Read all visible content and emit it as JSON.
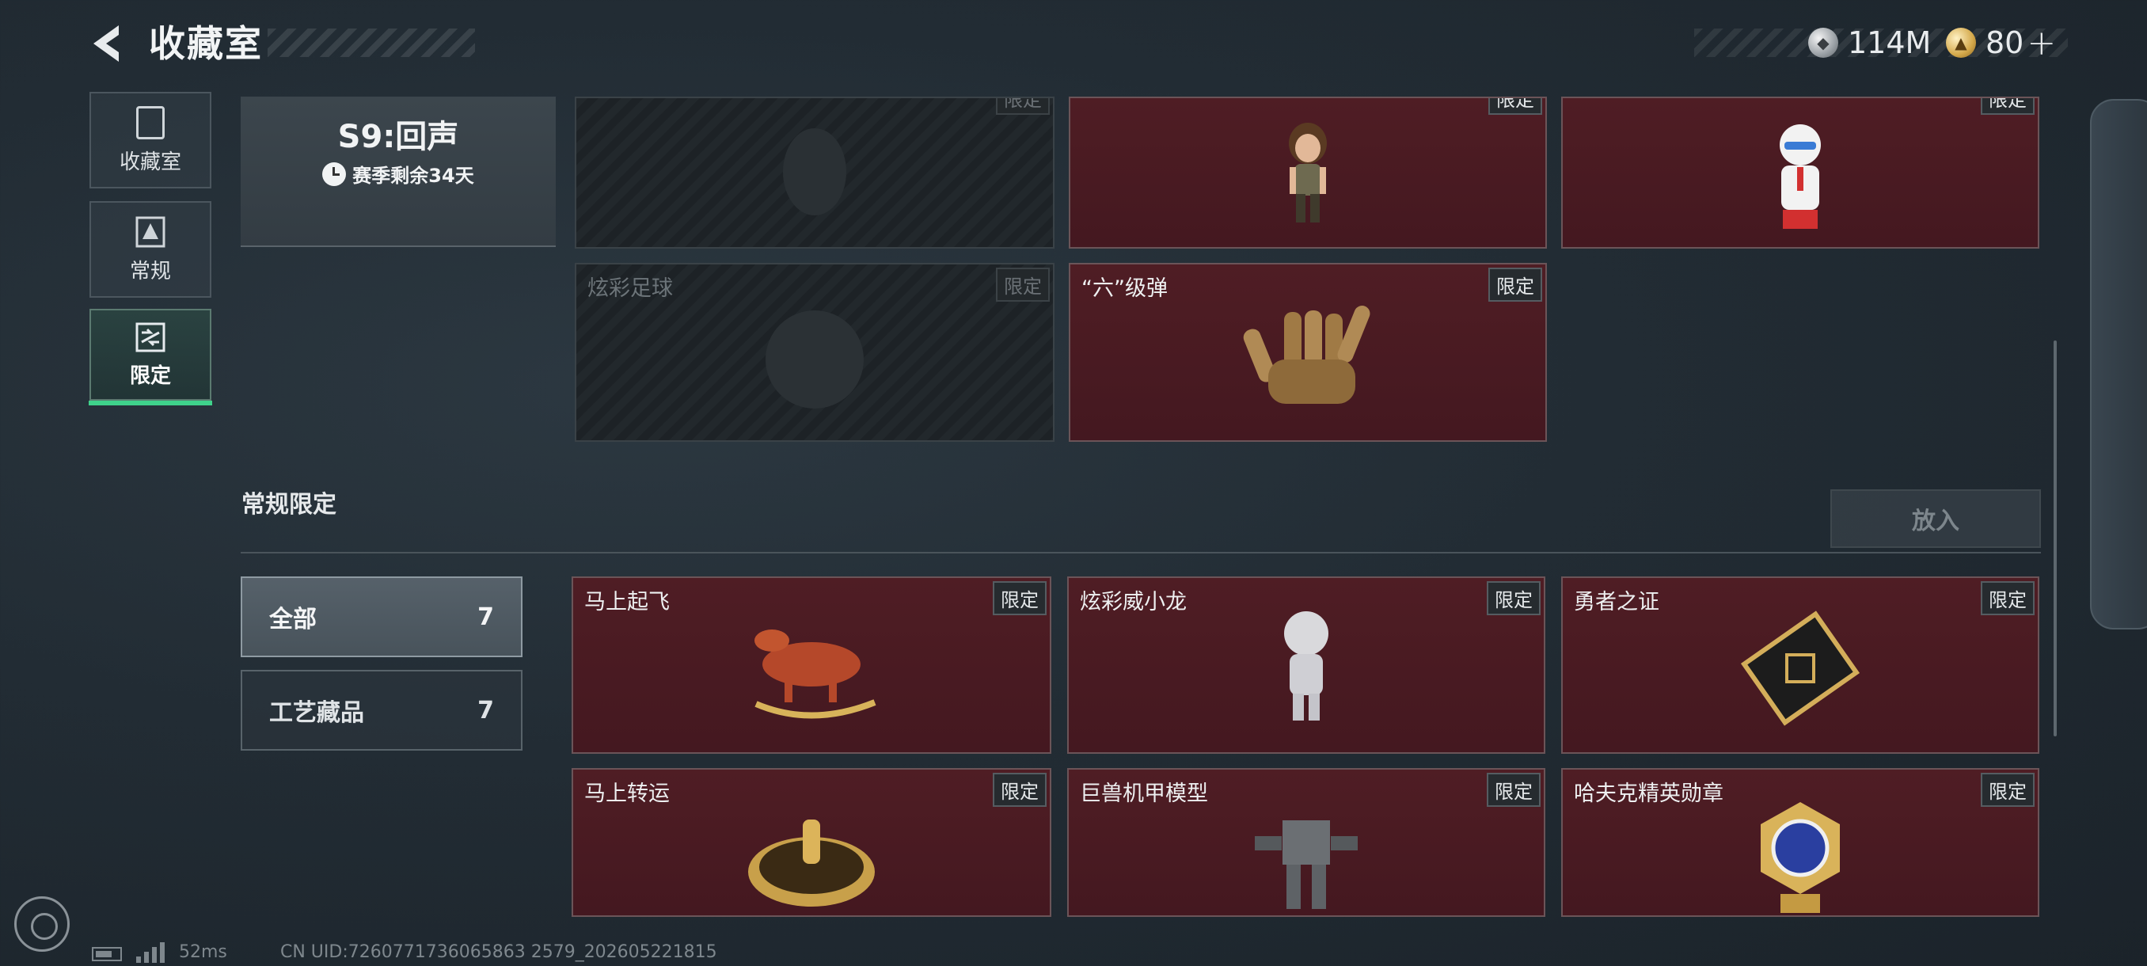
{
  "header": {
    "title": "收藏室",
    "currencies": [
      {
        "icon": "silver-coin-icon",
        "value": "114M"
      },
      {
        "icon": "gold-coin-icon",
        "value": "80"
      }
    ],
    "add_label": "+"
  },
  "nav": {
    "items": [
      {
        "label": "收藏室",
        "icon": "collection-room-icon",
        "active": false
      },
      {
        "label": "常规",
        "icon": "regular-icon",
        "active": false
      },
      {
        "label": "限定",
        "icon": "limited-icon",
        "active": true
      }
    ]
  },
  "season": {
    "title": "S9:回声",
    "remaining": "赛季剩余34天"
  },
  "limited_grid": [
    {
      "name": "",
      "tag": "限定",
      "locked": true
    },
    {
      "name": "",
      "tag": "限定",
      "locked": false
    },
    {
      "name": "",
      "tag": "限定",
      "locked": false
    },
    {
      "name": "炫彩足球",
      "tag": "限定",
      "locked": true
    },
    {
      "name": "“六”级弹",
      "tag": "限定",
      "locked": false
    }
  ],
  "section": {
    "title": "常规限定",
    "put_button": "放入"
  },
  "filters": [
    {
      "label": "全部",
      "count": "7",
      "active": true
    },
    {
      "label": "工艺藏品",
      "count": "7",
      "active": false
    }
  ],
  "items": [
    {
      "name": "马上起飞",
      "tag": "限定"
    },
    {
      "name": "炫彩威小龙",
      "tag": "限定"
    },
    {
      "name": "勇者之证",
      "tag": "限定"
    },
    {
      "name": "马上转运",
      "tag": "限定"
    },
    {
      "name": "巨兽机甲模型",
      "tag": "限定"
    },
    {
      "name": "哈夫克精英勋章",
      "tag": "限定"
    }
  ],
  "footer": {
    "ping": "52ms",
    "uid": "CN UID:7260771736065863 2579_202605221815"
  },
  "colors": {
    "card_bg": "#4f1d24",
    "accent_green": "#3fd28b"
  }
}
